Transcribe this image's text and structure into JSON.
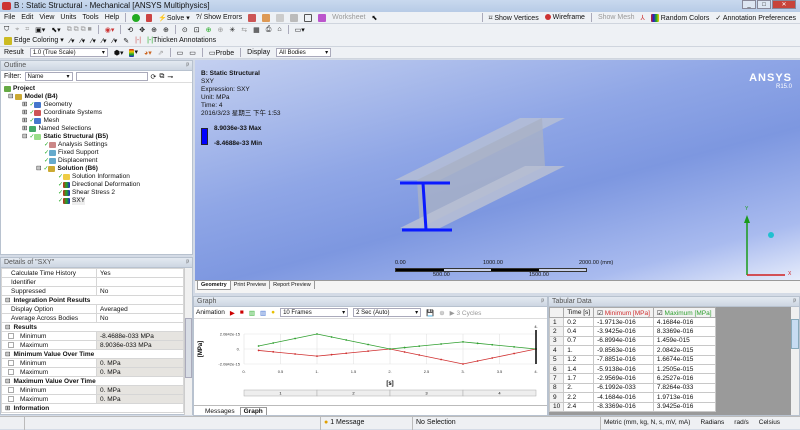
{
  "window": {
    "title": "B : Static Structural - Mechanical [ANSYS Multiphysics]"
  },
  "menu": [
    "File",
    "Edit",
    "View",
    "Units",
    "Tools",
    "Help"
  ],
  "toolbar1": {
    "solve": "Solve",
    "show_errors": "?/ Show Errors",
    "worksheet": "Worksheet",
    "show_vertices": "Show Vertices",
    "wireframe": "Wireframe",
    "show_mesh": "Show Mesh",
    "random_colors": "Random Colors",
    "annotation_preferences": "Annotation Preferences"
  },
  "toolbar3": {
    "edge_coloring": "Edge Coloring",
    "thicken_annotations": "Thicken Annotations"
  },
  "toolbar4": {
    "result_label": "Result",
    "result_scale": "1.0 (True Scale)",
    "probe": "Probe",
    "display_label": "Display",
    "display_value": "All Bodies"
  },
  "outline": {
    "title": "Outline",
    "filter_label": "Filter:",
    "filter_value": "Name",
    "project": "Project",
    "model": "Model (B4)",
    "items": [
      "Geometry",
      "Coordinate Systems",
      "Mesh",
      "Named Selections"
    ],
    "static": "Static Structural (B5)",
    "static_items": [
      "Analysis Settings",
      "Fixed Support",
      "Displacement"
    ],
    "solution": "Solution (B6)",
    "solution_items": [
      "Solution Information",
      "Directional Deformation",
      "Shear Stress 2",
      "SXY"
    ]
  },
  "details": {
    "title": "Details of \"SXY\"",
    "rows": [
      {
        "type": "row",
        "label": "Calculate Time History",
        "value": "Yes"
      },
      {
        "type": "row",
        "label": "Identifier",
        "value": ""
      },
      {
        "type": "row",
        "label": "Suppressed",
        "value": "No"
      },
      {
        "type": "group",
        "label": "Integration Point Results"
      },
      {
        "type": "row",
        "label": "Display Option",
        "value": "Averaged"
      },
      {
        "type": "row",
        "label": "Average Across Bodies",
        "value": "No"
      },
      {
        "type": "group",
        "label": "Results"
      },
      {
        "type": "crow",
        "label": "Minimum",
        "value": "-8.4688e-033 MPa"
      },
      {
        "type": "crow",
        "label": "Maximum",
        "value": "8.9036e-033 MPa"
      },
      {
        "type": "group",
        "label": "Minimum Value Over Time"
      },
      {
        "type": "crow",
        "label": "Minimum",
        "value": "0. MPa"
      },
      {
        "type": "crow",
        "label": "Maximum",
        "value": "0. MPa"
      },
      {
        "type": "group",
        "label": "Maximum Value Over Time"
      },
      {
        "type": "crow",
        "label": "Minimum",
        "value": "0. MPa"
      },
      {
        "type": "crow",
        "label": "Maximum",
        "value": "0. MPa"
      },
      {
        "type": "egroup",
        "label": "Information"
      }
    ]
  },
  "viewport": {
    "header": "B: Static Structural",
    "result": "SXY",
    "expression": "Expression: SXY",
    "unit": "Unit: MPa",
    "time": "Time: 4",
    "date": "2016/3/23 星期三 下午 1:53",
    "max_label": "8.9036e-33 Max",
    "min_label": "-8.4688e-33 Min",
    "logo": "ANSYS",
    "version": "R15.0",
    "scale": {
      "ticks_top": [
        "0.00",
        "1000.00",
        "2000.00 (mm)"
      ],
      "ticks_bottom": [
        "500.00",
        "1500.00"
      ]
    },
    "tabs": [
      "Geometry",
      "Print Preview",
      "Report Preview"
    ],
    "axis": {
      "x": "X",
      "y": "Y"
    },
    "colors": {
      "legend": "#0000ff",
      "beam_section": "#0a1aff"
    }
  },
  "graph": {
    "title": "Graph",
    "animation": "Animation",
    "frames": "10 Frames",
    "duration": "2 Sec (Auto)",
    "cycles": "3 Cycles",
    "tabs": [
      "Messages",
      "Graph"
    ],
    "steps": [
      "1",
      "2",
      "3",
      "4"
    ]
  },
  "chart_data": {
    "type": "line",
    "ylabel": "[MPa]",
    "xlabel": "[s]",
    "xlim": [
      0,
      4
    ],
    "ylim": [
      -2.0842e-15,
      2.0842e-15
    ],
    "xticks": [
      "0.",
      "0.5",
      "1.",
      "1.5",
      "2.",
      "2.5",
      "3.",
      "3.5",
      "4."
    ],
    "yticks": [
      "2.0842e-15",
      "0.",
      "-2.0842e-15"
    ],
    "cursor_label": "4.",
    "x": [
      0.2,
      0.4,
      0.7,
      1.0,
      1.2,
      1.4,
      1.7,
      2.0,
      2.2,
      2.4,
      2.7,
      3.0,
      3.2,
      3.4,
      3.7,
      4.0
    ],
    "series": [
      {
        "name": "Minimum [MPa]",
        "color": "#d03030",
        "values": [
          -1.9713e-16,
          -3.9425e-16,
          -6.8994e-16,
          -9.8563e-16,
          -7.8851e-16,
          -5.9138e-16,
          -2.9569e-16,
          -6.1992e-33,
          -4.1684e-16,
          -8.3369e-16,
          -1.459e-15,
          -2.0842e-15,
          -1.6674e-15,
          -1.2505e-15,
          -6.2527e-16,
          0
        ]
      },
      {
        "name": "Maximum [MPa]",
        "color": "#30a030",
        "values": [
          4.1684e-16,
          8.3369e-16,
          1.459e-15,
          2.0842e-15,
          1.6674e-15,
          1.2505e-15,
          6.2527e-16,
          7.8264e-33,
          1.9713e-16,
          3.9425e-16,
          6.8994e-16,
          9.8563e-16,
          7.8851e-16,
          5.9138e-16,
          2.9569e-16,
          0
        ]
      }
    ]
  },
  "tabular": {
    "title": "Tabular Data",
    "headers": [
      "Time [s]",
      "Minimum [MPa]",
      "Maximum [MPa]"
    ],
    "rows": [
      [
        "1",
        "0.2",
        "-1.9713e-016",
        "4.1684e-016"
      ],
      [
        "2",
        "0.4",
        "-3.9425e-016",
        "8.3369e-016"
      ],
      [
        "3",
        "0.7",
        "-6.8994e-016",
        "1.459e-015"
      ],
      [
        "4",
        "1.",
        "-9.8563e-016",
        "2.0842e-015"
      ],
      [
        "5",
        "1.2",
        "-7.8851e-016",
        "1.6674e-015"
      ],
      [
        "6",
        "1.4",
        "-5.9138e-016",
        "1.2505e-015"
      ],
      [
        "7",
        "1.7",
        "-2.9569e-016",
        "6.2527e-016"
      ],
      [
        "8",
        "2.",
        "-6.1992e-033",
        "7.8264e-033"
      ],
      [
        "9",
        "2.2",
        "-4.1684e-016",
        "1.9713e-016"
      ],
      [
        "10",
        "2.4",
        "-8.3369e-016",
        "3.9425e-016"
      ]
    ]
  },
  "status": {
    "messages": "1 Message",
    "selection": "No Selection",
    "units": "Metric (mm, kg, N, s, mV, mA)",
    "angle": "Radians",
    "rot": "rad/s",
    "temp": "Celsius"
  }
}
